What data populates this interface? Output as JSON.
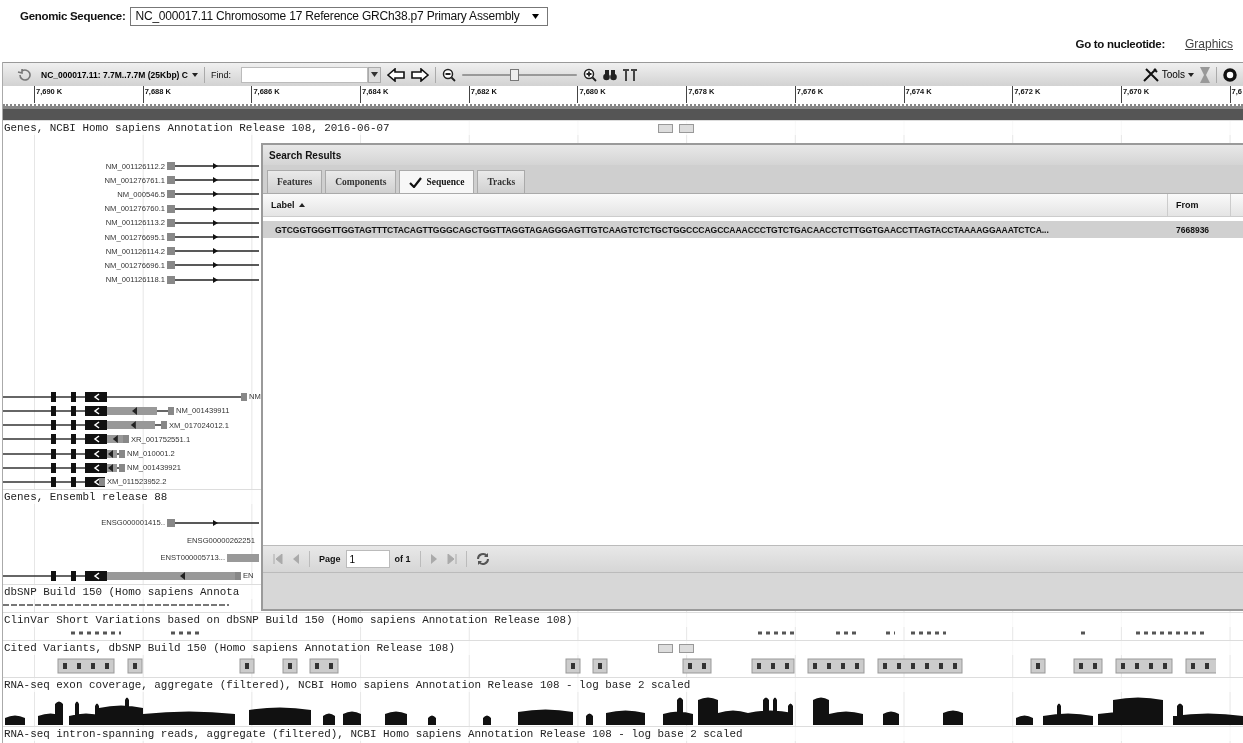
{
  "header": {
    "label": "Genomic Sequence:",
    "assembly": "NC_000017.11 Chromosome 17 Reference GRCh38.p7 Primary Assembly",
    "goto_label": "Go to nucleotide:",
    "graphics_link": "Graphics"
  },
  "toolbar": {
    "region": "NC_000017.11: 7.7M..7.7M (25Kbp) C",
    "find_label": "Find:",
    "zoom": {
      "level": 0.45
    },
    "tools": "Tools"
  },
  "ruler": [
    "7,690 K",
    "7,688 K",
    "7,686 K",
    "7,684 K",
    "7,682 K",
    "7,680 K",
    "7,678 K",
    "7,676 K",
    "7,674 K",
    "7,672 K",
    "7,670 K",
    "7,6"
  ],
  "tracks": [
    {
      "kind": "genes",
      "title": "Genes, NCBI Homo sapiens Annotation Release 108, 2016-06-07",
      "groups": [
        {
          "rows": [
            {
              "kind": "forward",
              "label": "NM_001126112.2"
            },
            {
              "kind": "forward",
              "label": "NM_001276761.1"
            },
            {
              "kind": "forward",
              "label": "NM_000546.5"
            },
            {
              "kind": "forward",
              "label": "NM_001276760.1"
            },
            {
              "kind": "forward",
              "label": "NM_001126113.2"
            },
            {
              "kind": "forward",
              "label": "NM_001276695.1"
            },
            {
              "kind": "forward",
              "label": "NM_001126114.2"
            },
            {
              "kind": "forward",
              "label": "NM_001276696.1"
            },
            {
              "kind": "forward",
              "label": "NM_001126118.1"
            }
          ]
        },
        {
          "rows": [
            {
              "kind": "reverse",
              "label": "NM"
            },
            {
              "kind": "reverse",
              "label": "NM_001439911"
            },
            {
              "kind": "reverse",
              "label": "XM_017024012.1"
            },
            {
              "kind": "reverse",
              "label": "XR_001752551.1"
            },
            {
              "kind": "reverse",
              "label": "NM_010001.2"
            },
            {
              "kind": "reverse",
              "label": "NM_001439921"
            },
            {
              "kind": "reverse",
              "label": "XM_011523952.2"
            }
          ]
        }
      ]
    },
    {
      "kind": "genes",
      "title": "Genes, Ensembl release 88",
      "groups": [
        {
          "rows": [
            {
              "kind": "forward",
              "label": "ENSG000001415.."
            },
            {
              "kind": "label",
              "label": "ENSG00000262251"
            },
            {
              "kind": "bar",
              "label": "ENST000005713..."
            },
            {
              "kind": "reverse",
              "label": "EN"
            }
          ]
        }
      ]
    },
    {
      "kind": "marks",
      "title": "dbSNP Build 150 (Homo sapiens Annota"
    },
    {
      "kind": "marks",
      "title": "ClinVar Short Variations based on dbSNP Build 150 (Homo sapiens Annotation Release 108)"
    },
    {
      "kind": "cited",
      "title": "Cited Variants, dbSNP Build 150 (Homo sapiens Annotation Release 108)"
    },
    {
      "kind": "coverage",
      "title": "RNA-seq exon coverage, aggregate (filtered), NCBI Homo sapiens Annotation Release 108 - log base 2 scaled"
    },
    {
      "kind": "title",
      "title": "RNA-seq intron-spanning reads, aggregate (filtered), NCBI Homo sapiens Annotation Release 108 - log base 2 scaled"
    }
  ],
  "search_results": {
    "title": "Search Results",
    "tabs": [
      {
        "label": "Features",
        "selected": false
      },
      {
        "label": "Components",
        "selected": false
      },
      {
        "label": "Sequence",
        "selected": true
      },
      {
        "label": "Tracks",
        "selected": false
      }
    ],
    "columns": [
      "Label",
      "From"
    ],
    "rows": [
      {
        "label": "GTCGGTGGGTTGGTAGTTTCTACAGTTGGGCAGCTGGTTAGGTAGAGGGAGTTGTCAAGTCTCTGCTGGCCCAGCCAAACCCTGTCTGACAACCTCTTGGTGAACCTTAGTACCTAAAAGGAAATCTCA...",
        "from": "7668936",
        "selected": true
      }
    ],
    "pager": {
      "page_label": "Page",
      "page": "1",
      "of": "of 1"
    }
  }
}
